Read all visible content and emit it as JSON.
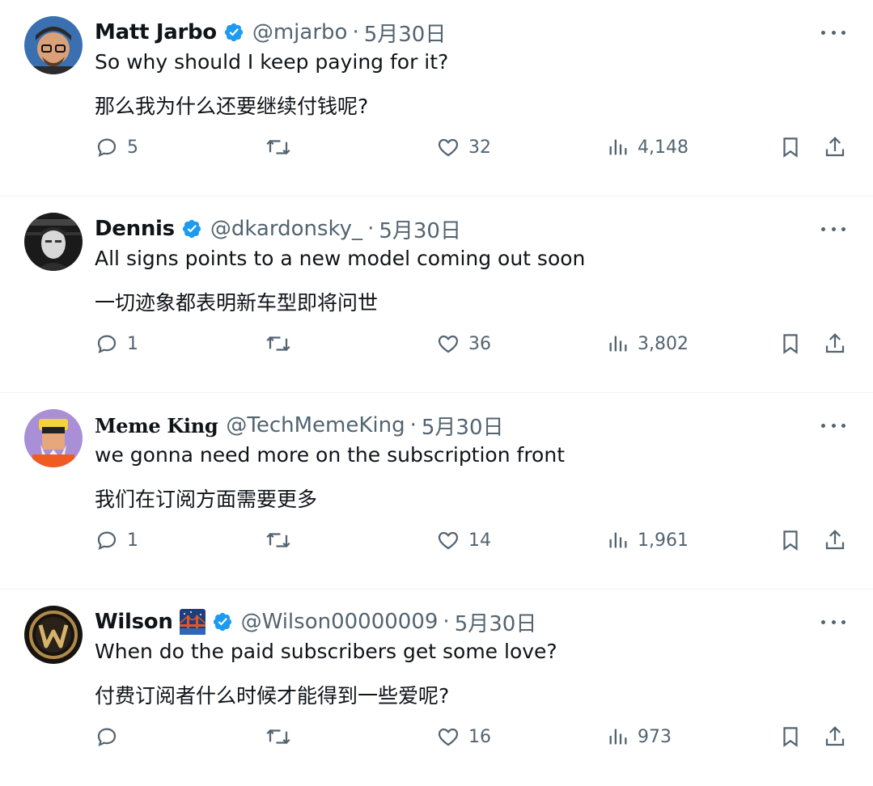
{
  "tweets": [
    {
      "name": "Matt Jarbo",
      "verified": true,
      "handle": "@mjarbo",
      "date": "5月30日",
      "text_en": "So why should I keep paying for it?",
      "text_zh": "那么我为什么还要继续付钱呢?",
      "replies": "5",
      "retweets": "",
      "likes": "32",
      "views": "4,148"
    },
    {
      "name": "Dennis",
      "verified": true,
      "handle": "@dkardonsky_",
      "date": "5月30日",
      "text_en": "All signs points to a new model coming out soon",
      "text_zh": "一切迹象都表明新车型即将问世",
      "replies": "1",
      "retweets": "",
      "likes": "36",
      "views": "3,802"
    },
    {
      "name": "𝐌𝐞𝐦𝐞 𝐊𝐢𝐧𝐠",
      "verified": false,
      "handle": "@TechMemeKing",
      "date": "5月30日",
      "text_en": "we gonna need more on the subscription front",
      "text_zh": "我们在订阅方面需要更多",
      "replies": "1",
      "retweets": "",
      "likes": "14",
      "views": "1,961"
    },
    {
      "name": "Wilson",
      "verified": true,
      "handle": "@Wilson00000009",
      "date": "5月30日",
      "text_en": "When do the paid subscribers get some love?",
      "text_zh": "付费订阅者什么时候才能得到一些爱呢?",
      "replies": "",
      "retweets": "",
      "likes": "16",
      "views": "973"
    }
  ],
  "separator": "·",
  "colors": {
    "text": "#0f1419",
    "secondary": "#536471",
    "verified": "#1d9bf0",
    "divider": "#eff3f4"
  },
  "icons": [
    "reply-icon",
    "retweet-icon",
    "like-icon",
    "views-icon",
    "bookmark-icon",
    "share-icon",
    "more-icon",
    "verified-badge-icon"
  ]
}
